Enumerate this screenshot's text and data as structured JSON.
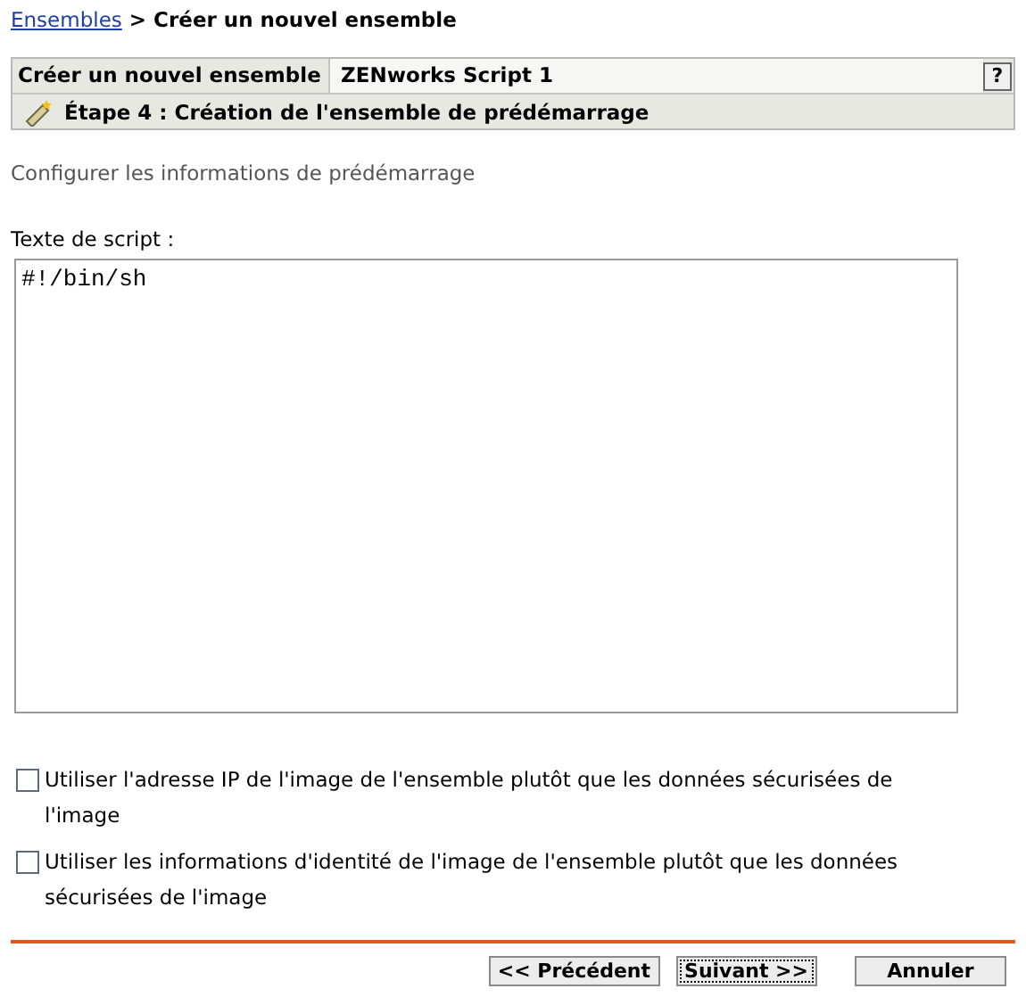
{
  "breadcrumb": {
    "link": "Ensembles",
    "separator": ">",
    "current": "Créer un nouvel ensemble"
  },
  "header": {
    "wizard_title": "Créer un nouvel ensemble",
    "bundle_name": "ZENworks Script 1",
    "help": "?",
    "step": "Étape 4 : Création de l'ensemble de prédémarrage"
  },
  "subtitle": "Configurer les informations de prédémarrage",
  "script_field": {
    "label": "Texte de script :",
    "value": "#!/bin/sh"
  },
  "options": [
    {
      "label": "Utiliser l'adresse IP de l'image de l'ensemble plutôt que les données sécurisées de l'image",
      "checked": false
    },
    {
      "label": "Utiliser les informations d'identité de l'image de l'ensemble plutôt que les données sécurisées de l'image",
      "checked": false
    }
  ],
  "buttons": [
    {
      "label": "<< Précédent",
      "focused": false
    },
    {
      "label": "Suivant >>",
      "focused": true
    },
    {
      "label": "Annuler",
      "focused": false
    }
  ]
}
